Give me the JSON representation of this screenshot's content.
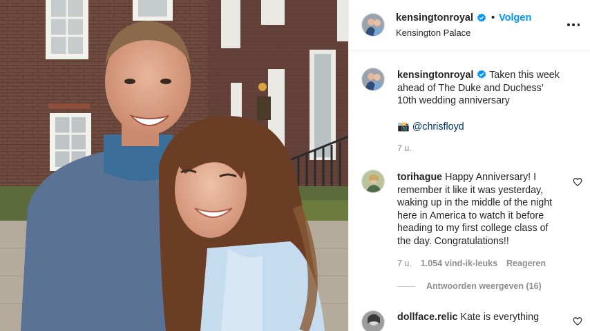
{
  "header": {
    "username": "kensingtonroyal",
    "follow_label": "Volgen",
    "separator": "•",
    "location": "Kensington Palace"
  },
  "caption": {
    "username": "kensingtonroyal",
    "text": "Taken this week ahead of The Duke and Duchess’ 10th wedding anniversary",
    "credit_emoji": "📸",
    "credit_mention": "@chrisfloyd",
    "time": "7 u."
  },
  "comments": [
    {
      "username": "torihague",
      "text": "Happy Anniversary! I remember it like it was yesterday, waking up in the middle of the night here in America to watch it before heading to my first college class of the day. Congratulations!!",
      "time": "7 u.",
      "likes": "1.054 vind-ik-leuks",
      "reply_label": "Reageren",
      "view_replies": "Antwoorden weergeven (16)"
    },
    {
      "username": "dollface.relic",
      "text": "Kate is everything"
    }
  ],
  "icons": {
    "verified": "verified-badge-icon",
    "more": "more-options-icon",
    "like": "heart-outline-icon"
  },
  "colors": {
    "accent": "#0095f6",
    "text": "#262626",
    "muted": "#8e8e8e",
    "mention": "#00376b"
  }
}
